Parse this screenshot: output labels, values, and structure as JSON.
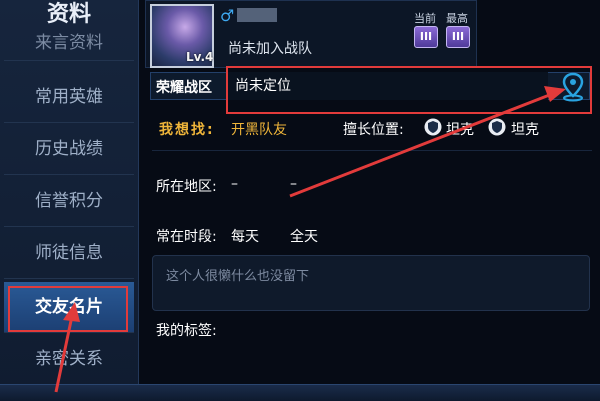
{
  "sidebar": {
    "title": "资料",
    "items": [
      {
        "label": "来言资料"
      },
      {
        "label": "常用英雄"
      },
      {
        "label": "历史战绩"
      },
      {
        "label": "信誉积分"
      },
      {
        "label": "师徒信息"
      },
      {
        "label": "交友名片",
        "active": true
      },
      {
        "label": "亲密关系"
      }
    ]
  },
  "profile": {
    "level": "Lv.4",
    "gender_icon": "male-symbol",
    "team_status": "尚未加入战队",
    "rank_current_label": "当前",
    "rank_highest_label": "最高",
    "rank_current_badge": "III",
    "rank_highest_badge": "III"
  },
  "zone": {
    "label": "荣耀战区",
    "value": "尚未定位",
    "locate_icon": "location-pin-icon"
  },
  "find": {
    "label": "我想找:",
    "value": "开黑队友",
    "position_label": "擅长位置:",
    "positions": [
      {
        "label": "坦克",
        "icon": "shield-icon"
      },
      {
        "label": "坦克",
        "icon": "shield-icon"
      }
    ]
  },
  "location": {
    "label": "所在地区:",
    "value1": "–",
    "value2": "–"
  },
  "time": {
    "label": "常在时段:",
    "value1": "每天",
    "value2": "全天"
  },
  "bio": {
    "text": "这个人很懒什么也没留下"
  },
  "signature": {
    "label": "我的标签:"
  },
  "colors": {
    "accent_gold": "#f0b63a",
    "annotation_red": "#e23b3b",
    "active_blue": "#2a5a96",
    "pin_blue": "#29a3e0"
  }
}
